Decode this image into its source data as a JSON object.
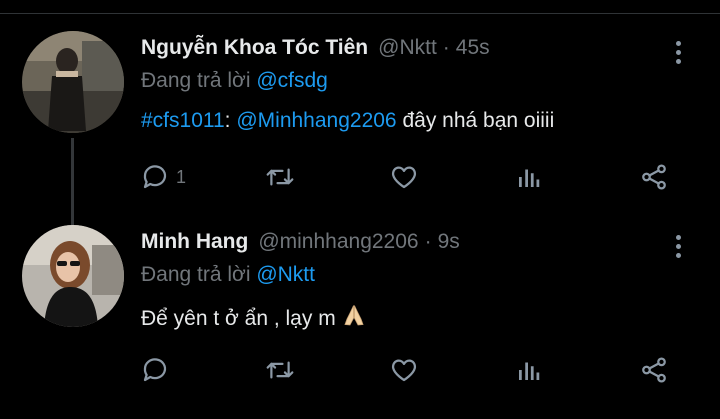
{
  "tweets": [
    {
      "name": "Nguyễn Khoa Tóc Tiên",
      "handle": "@Nktt",
      "separator": "·",
      "time": "45s",
      "replying_prefix": "Đang trả lời ",
      "replying_to": "@cfsdg",
      "text_hashtag": "#cfs1011",
      "text_colon": ": ",
      "text_mention": "@Minhhang2206",
      "text_rest": " đây nhá bạn oiiii",
      "reply_count": "1",
      "icons": [
        "reply-icon",
        "retweet-icon",
        "like-icon",
        "stats-icon",
        "share-icon",
        "more-icon"
      ]
    },
    {
      "name": "Minh Hang",
      "handle": "@minhhang2206",
      "separator": "·",
      "time": "9s",
      "replying_prefix": "Đang trả lời ",
      "replying_to": "@Nktt",
      "text": "Để yên t ở ẩn , lạy m",
      "emoji": "🙏",
      "icons": [
        "reply-icon",
        "retweet-icon",
        "like-icon",
        "stats-icon",
        "share-icon",
        "more-icon"
      ]
    }
  ],
  "colors": {
    "background": "#000000",
    "primary_text": "#e7e9ea",
    "secondary_text": "#71767b",
    "link": "#1d9bf0",
    "icon": "#8b98a5"
  }
}
